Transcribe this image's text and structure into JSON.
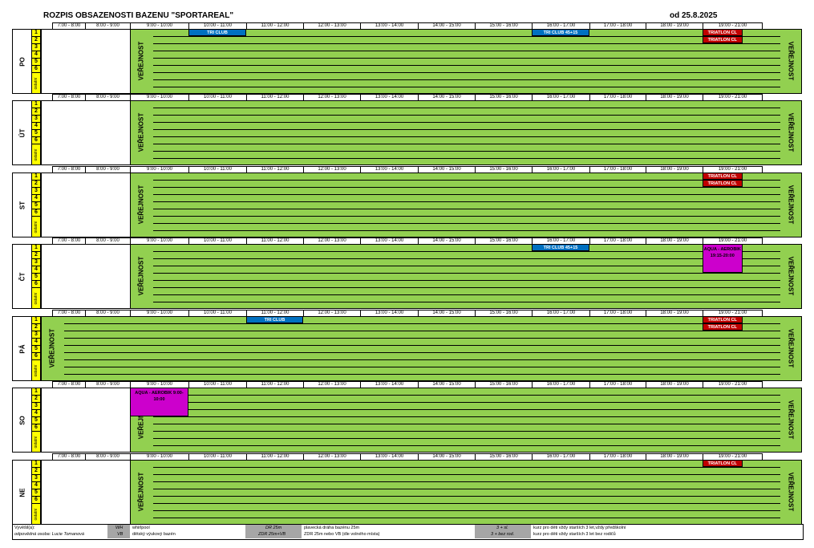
{
  "title": "ROZPIS OBSAZENOSTI BAZENU \"SPORTAREAL\"",
  "since": "od 25.8.2025",
  "hours": [
    "7:00 - 8:00",
    "8:00 - 9:00",
    "9:00 - 10:00",
    "10:00 - 11:00",
    "11:00 - 12:00",
    "12:00 - 13:00",
    "13:00 - 14:00",
    "14:00 - 15:00",
    "15:00 - 16:00",
    "16:00 - 17:00",
    "17:00 - 18:00",
    "18:00 - 19:00",
    "19:00 - 21:00"
  ],
  "lanes": [
    "1",
    "2",
    "3",
    "4",
    "5",
    "6"
  ],
  "other_label": "ostatní",
  "public_label": "VEŘEJNOST",
  "days": [
    {
      "name": "PO",
      "green_from": 2,
      "public_left": true,
      "public_right": true,
      "events": [
        {
          "label": "TRI CLUB",
          "color": "blue",
          "col": 3,
          "lane": 0,
          "lanes": 1,
          "span": 1
        },
        {
          "label": "TRI CLUB 45+15",
          "color": "blue",
          "col": 9,
          "lane": 0,
          "lanes": 1,
          "span": 1
        },
        {
          "label": "TRIATLON CL",
          "color": "red",
          "col": 12,
          "lane": 0,
          "lanes": 1,
          "span": 0.67
        },
        {
          "label": "TRIATLON CL",
          "color": "red",
          "col": 12,
          "lane": 1,
          "lanes": 1,
          "span": 0.67
        }
      ]
    },
    {
      "name": "ÚT",
      "green_from": 2,
      "public_left": true,
      "public_right": true,
      "events": []
    },
    {
      "name": "ST",
      "green_from": 2,
      "public_left": true,
      "public_right": true,
      "events": [
        {
          "label": "TRIATLON CL",
          "color": "red",
          "col": 12,
          "lane": 0,
          "lanes": 1,
          "span": 0.67
        },
        {
          "label": "TRIATLON CL",
          "color": "red",
          "col": 12,
          "lane": 1,
          "lanes": 1,
          "span": 0.67
        }
      ]
    },
    {
      "name": "ČT",
      "green_from": 2,
      "public_left": true,
      "public_right": true,
      "events": [
        {
          "label": "TRI CLUB 45+15",
          "color": "blue",
          "col": 9,
          "lane": 0,
          "lanes": 1,
          "span": 1
        },
        {
          "label": "AQUA - AEROBIK 19:15-20:00",
          "color": "mag",
          "col": 12,
          "lane": 0,
          "lanes": 4,
          "span": 0.67
        }
      ]
    },
    {
      "name": "PÁ",
      "green_from": 0,
      "public_left": true,
      "public_right": true,
      "events": [
        {
          "label": "TRI CLUB",
          "color": "blue",
          "col": 4,
          "lane": 0,
          "lanes": 1,
          "span": 1
        },
        {
          "label": "TRIATLON CL",
          "color": "red",
          "col": 12,
          "lane": 0,
          "lanes": 1,
          "span": 0.67
        },
        {
          "label": "TRIATLON CL",
          "color": "red",
          "col": 12,
          "lane": 1,
          "lanes": 1,
          "span": 0.67
        }
      ]
    },
    {
      "name": "SO",
      "green_from": 2,
      "public_left": true,
      "public_right": true,
      "events": [
        {
          "label": "AQUA - AEROBIK 9:00-10:00",
          "color": "mag",
          "col": 2,
          "lane": 0,
          "lanes": 4,
          "span": 1
        }
      ]
    },
    {
      "name": "NE",
      "green_from": 2,
      "public_left": true,
      "public_right": true,
      "events": [
        {
          "label": "TRIATLON CL",
          "color": "red",
          "col": 12,
          "lane": 0,
          "lanes": 1,
          "span": 0.67
        }
      ]
    }
  ],
  "legend": {
    "issued_by": "Vyvěšil(a):",
    "responsible": "odpovědná osoba: Lucie Tomanová",
    "wh_code": "WH",
    "wh_text": "whirlpool",
    "vb_code": "VB",
    "vb_text": "dětský výukový bazén",
    "dr_code": "DR 25m",
    "dr_text": "plavecká dráha bazénu 25m",
    "zdr_code": "ZDR 25m+VB",
    "zdr_text": "ZDR 25m nebo VB (dle volného místa)",
    "p_code": "3 + sl.",
    "p_text": "kurz pro děti vždy starších 3 let,vždy předškolní",
    "r_code": "3 + bez rod.",
    "r_text": "kurz pro děti vždy starších 3 let bez rodičů"
  }
}
